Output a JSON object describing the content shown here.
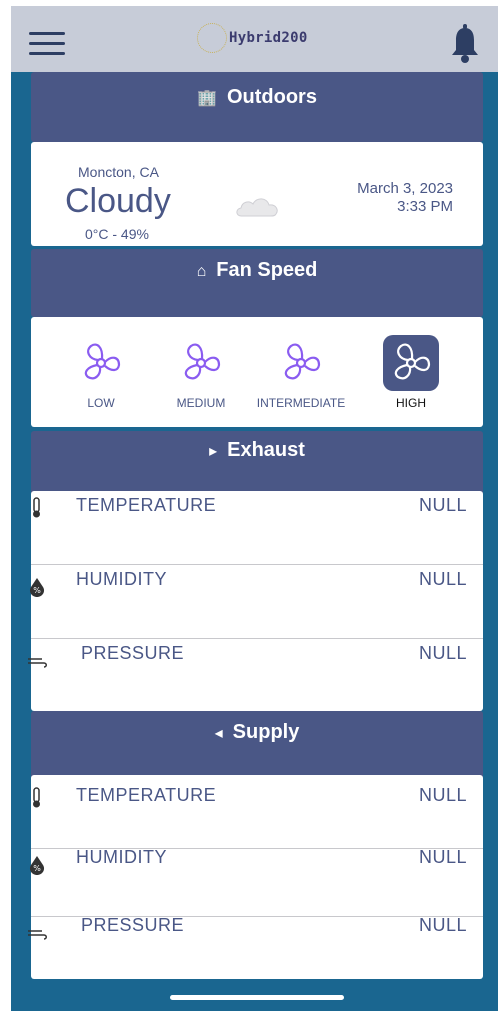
{
  "app": {
    "title": "Hybrid200"
  },
  "outdoors": {
    "title": "Outdoors",
    "icon": "building-icon",
    "location": "Moncton, CA",
    "condition": "Cloudy",
    "temp_humidity": "0°C - 49%",
    "date": "March 3, 2023",
    "time": "3:33 PM"
  },
  "fan_speed": {
    "title": "Fan Speed",
    "icon": "home-icon",
    "options": [
      {
        "label": "LOW",
        "active": false
      },
      {
        "label": "MEDIUM",
        "active": false
      },
      {
        "label": "INTERMEDIATE",
        "active": false
      },
      {
        "label": "HIGH",
        "active": true
      }
    ],
    "colors": {
      "active_bg": "#4a5786",
      "fan_outline": "#8a5cf0"
    }
  },
  "exhaust": {
    "title": "Exhaust",
    "icon": "caret-right-icon",
    "rows": [
      {
        "label": "TEMPERATURE",
        "value": "NULL",
        "icon": "thermometer-icon"
      },
      {
        "label": "HUMIDITY",
        "value": "NULL",
        "icon": "humidity-icon"
      },
      {
        "label": "PRESSURE",
        "value": "NULL",
        "icon": "wind-icon"
      }
    ]
  },
  "supply": {
    "title": "Supply",
    "icon": "caret-left-icon",
    "rows": [
      {
        "label": "TEMPERATURE",
        "value": "NULL",
        "icon": "thermometer-icon"
      },
      {
        "label": "HUMIDITY",
        "value": "NULL",
        "icon": "humidity-icon"
      },
      {
        "label": "PRESSURE",
        "value": "NULL",
        "icon": "wind-icon"
      }
    ]
  },
  "theme": {
    "header_bg": "#4a5786",
    "page_bg": "#1a6690",
    "topbar_bg": "#c7ccd8"
  }
}
